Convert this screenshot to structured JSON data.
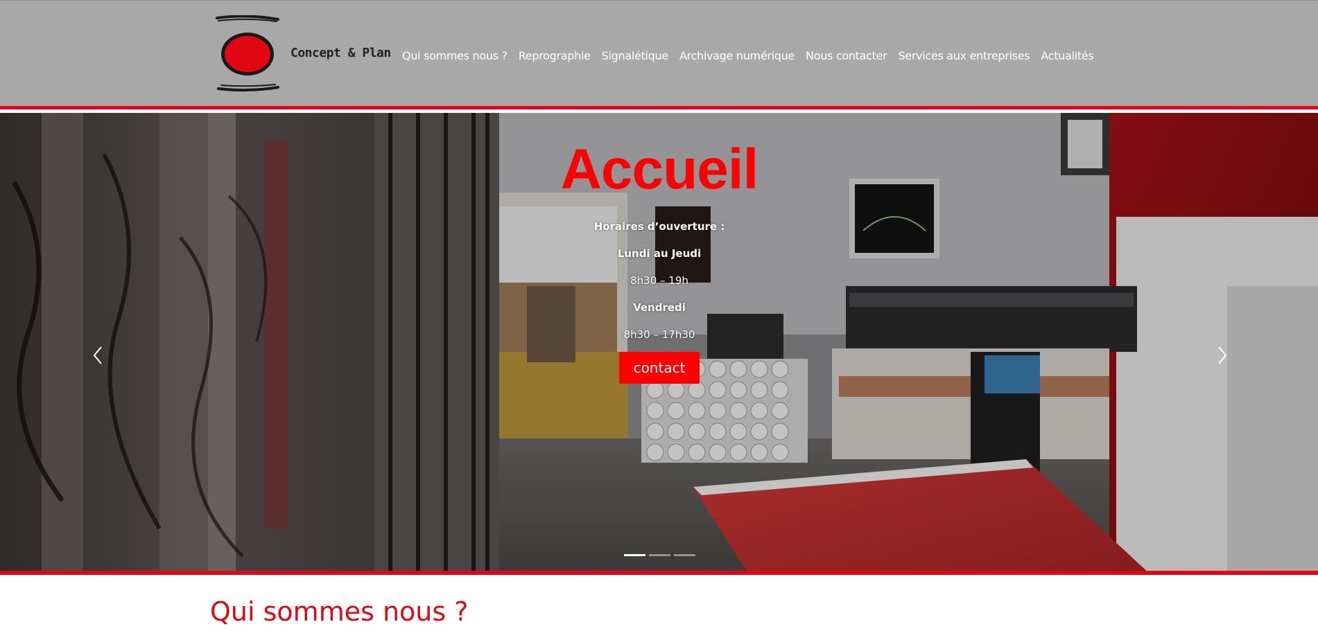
{
  "header": {
    "logo_text": "Concept & Plan",
    "nav_items": [
      "Qui sommes nous ?",
      "Reprographie",
      "Signalétique",
      "Archivage numérique",
      "Nous contacter",
      "Services aux entreprises",
      "Actualités"
    ]
  },
  "hero": {
    "title": "Accueil",
    "hours_label": "Horaires d’ouverture :",
    "weekdays_label": "Lundi au Jeudi",
    "weekdays_hours": "8h30 – 19h",
    "friday_label": "Vendredi",
    "friday_hours": "8h30 – 17h30",
    "button_label": "contact",
    "prev_icon": "chevron-left-icon",
    "next_icon": "chevron-right-icon",
    "slides_count": 3,
    "active_slide": 1
  },
  "section": {
    "title": "Qui sommes nous ?"
  },
  "colors": {
    "brand_red": "#e30613",
    "header_bg": "#a8a8a8",
    "title_red": "#ff0000"
  }
}
